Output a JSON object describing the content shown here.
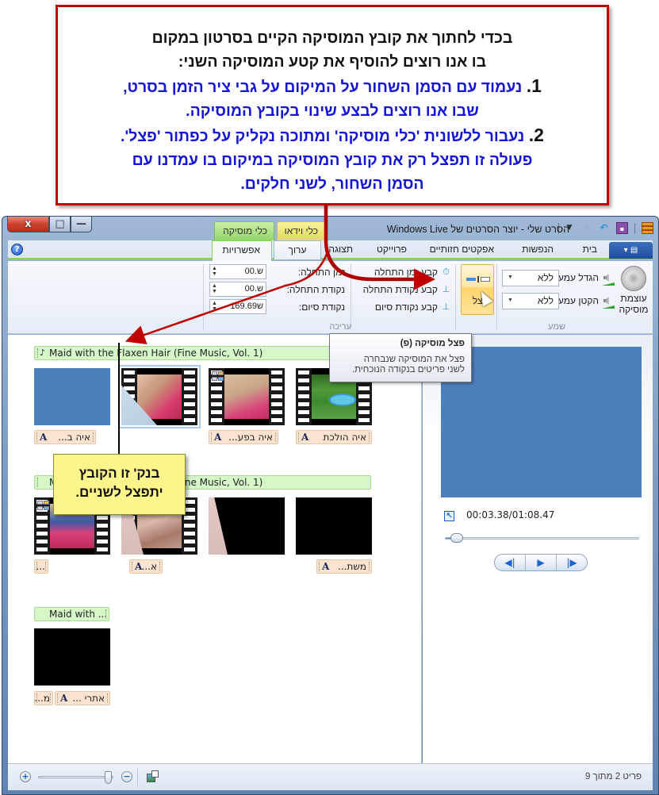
{
  "annotation": {
    "lines": [
      {
        "text": "בכדי לחתוך את קובץ המוסיקה הקיים בסרטון במקום",
        "color": "black"
      },
      {
        "text": "בו אנו רוצים להוסיף את קטע המוסיקה השני:",
        "color": "black"
      },
      {
        "num": "1.",
        "text": " נעמוד עם הסמן השחור על המיקום על גבי ציר הזמן בסרט,",
        "color": "blue"
      },
      {
        "text": "שבו אנו רוצים לבצע שינוי בקובץ המוסיקה.",
        "color": "blue"
      },
      {
        "num": "2.",
        "text": " נעבור ללשונית 'כלי מוסיקה' ומתוכה נקליק על כפתור 'פצל'.",
        "color": "blue"
      },
      {
        "text": "פעולה זו תפצל רק את קובץ המוסיקה במיקום בו עמדנו עם",
        "color": "blue"
      },
      {
        "text": "הסמן השחור, לשני חלקים.",
        "color": "blue"
      }
    ],
    "border_color": "#c00000",
    "text_blue": "#1414d6"
  },
  "callout": {
    "line1": "בנק' זו הקובץ",
    "line2": "יתפצל לשניים."
  },
  "window": {
    "title": "הסרט שלי - יוצר הסרטים של Windows Live",
    "controls": {
      "close": "x",
      "maximize": "□",
      "minimize": "—"
    },
    "contextual_tabs": {
      "video_tools": "כלי וידאו",
      "music_tools": "כלי מוסיקה"
    }
  },
  "ribbon": {
    "tabs": [
      {
        "label": "בית"
      },
      {
        "label": "הנפשות"
      },
      {
        "label": "אפקטים חזותיים"
      },
      {
        "label": "פרוייקט"
      },
      {
        "label": "תצוגה"
      },
      {
        "label": "ערוך"
      },
      {
        "label": "אפשרויות",
        "active": true
      }
    ],
    "audio_group": {
      "label": "שמע",
      "music_volume": "עוצמת מוסיקה",
      "music_volume_line1": "עוצמת",
      "music_volume_line2": "מוסיקה",
      "fade_in_label": "הגדל עמעום:",
      "fade_in_value": "ללא",
      "fade_out_label": "הקטן עמעום:",
      "fade_out_value": "ללא"
    },
    "split_button": {
      "label": "פצל"
    },
    "edit_group": {
      "label": "עריכה",
      "set_start_time": "קבע זמן התחלה",
      "set_start_point": "קבע נקודת התחלה",
      "set_end_point": "קבע נקודת סיום",
      "start_time_label": "זמן התחלה:",
      "start_time_value": "00.ש",
      "start_point_label": "נקודת התחלה:",
      "start_point_value": "00.ש",
      "end_point_label": "נקודת סיום:",
      "end_point_value": "169.69ש"
    }
  },
  "tooltip": {
    "title": "פצל מוסיקה (פ)",
    "body_line1": "פצל את המוסיקה שנבחרה",
    "body_line2": "לשני פריטים בנקודה הנוכחית."
  },
  "storyboard": {
    "rows": [
      {
        "music": "Maid with the Flaxen Hair (Fine Music, Vol. 1)",
        "clips": [
          {
            "type": "blue",
            "caption": "איה ב..."
          },
          {
            "type": "video",
            "caption": ""
          },
          {
            "type": "video",
            "caption": "איה בפע..."
          },
          {
            "type": "video",
            "caption": "איה הולכת"
          }
        ]
      },
      {
        "music": "Maid with the Flaxen Hair (Fine Music, Vol. 1)",
        "music_visible_left": "M",
        "music_visible_right": "Music, Vol. 1)",
        "clips": [
          {
            "type": "video",
            "caption": "..."
          },
          {
            "type": "video",
            "caption": "א..."
          },
          {
            "type": "black",
            "caption": ""
          },
          {
            "type": "black",
            "caption": "משת..."
          }
        ]
      },
      {
        "music": "Maid with ...",
        "clips": [
          {
            "type": "black",
            "caption": "אתרי ...",
            "caption2": "מ..."
          }
        ]
      }
    ]
  },
  "preview": {
    "timecode": "00:03.38/01:08.47",
    "position_fraction": 0.05,
    "buttons": {
      "prev": "◀|",
      "play": "▶",
      "next": "|▶"
    }
  },
  "statusbar": {
    "item_status": "פריט 2 מתוך 9",
    "zoom_in": "+",
    "zoom_out": "−",
    "zoom_level_fraction": 0.98
  }
}
